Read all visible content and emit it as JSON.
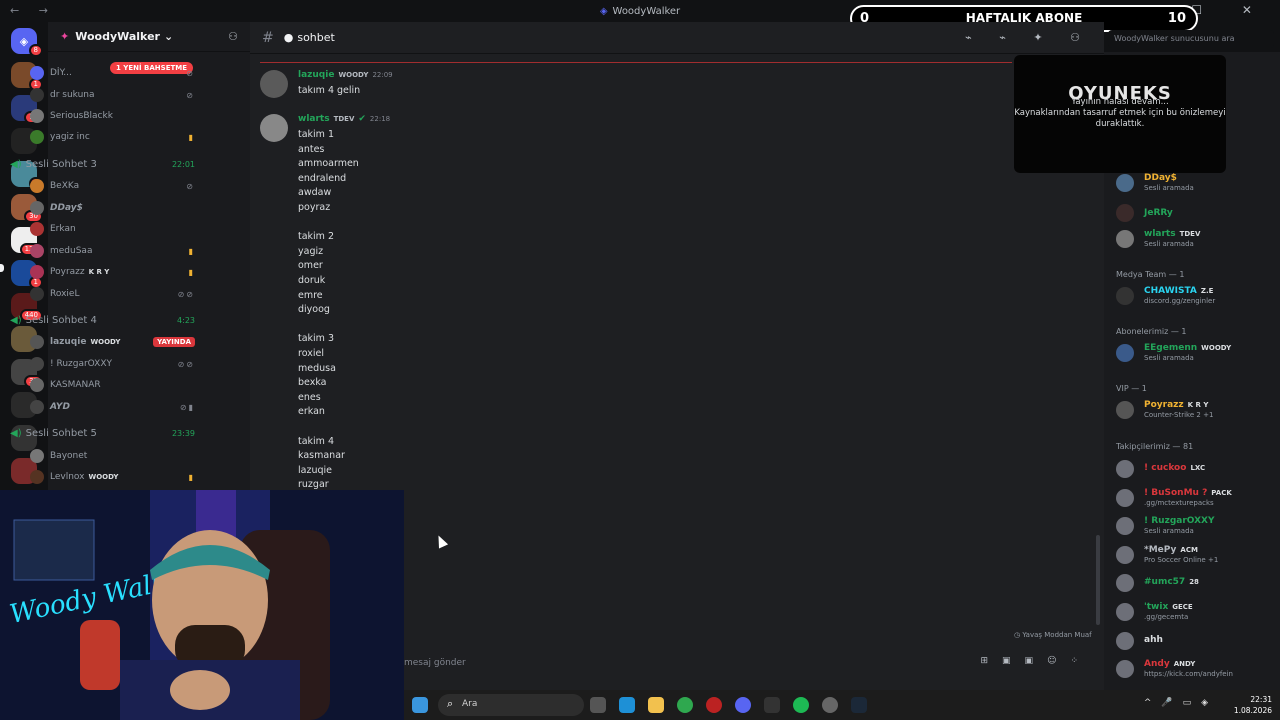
{
  "window": {
    "title": "WoodyWalker"
  },
  "server": {
    "name": "WoodyWalker",
    "new_mentions": "1 YENİ BAHSETME"
  },
  "server_badges": [
    "8",
    "1",
    "16",
    "",
    "",
    "3",
    "30",
    "126",
    "1",
    "440",
    "",
    "",
    "33",
    "",
    "",
    ""
  ],
  "voice_top_users": [
    {
      "name": "DİY..."
    },
    {
      "name": "dr sukuna"
    },
    {
      "name": "SeriousBlackk"
    },
    {
      "name": "yagiz inc"
    }
  ],
  "voice_channels": [
    {
      "name": "Sesli Sohbet 3",
      "time": "22:01",
      "live": "",
      "users": [
        {
          "name": "BeXKa",
          "tag": ""
        },
        {
          "name": "DDay$",
          "tag": ""
        },
        {
          "name": "Erkan",
          "tag": ""
        },
        {
          "name": "meduSaa",
          "tag": ""
        },
        {
          "name": "Poyrazz",
          "tag": "K R Y"
        },
        {
          "name": "RoxieL",
          "tag": ""
        }
      ]
    },
    {
      "name": "Sesli Sohbet 4",
      "time": "4:23",
      "live": "YAYINDA",
      "users": [
        {
          "name": "lazuqie",
          "tag": "WOODY"
        },
        {
          "name": "! RuzgarOXXY",
          "tag": ""
        },
        {
          "name": "KASMANAR",
          "tag": ""
        },
        {
          "name": "AYD",
          "tag": ""
        }
      ]
    },
    {
      "name": "Sesli Sohbet 5",
      "time": "23:39",
      "live": "",
      "users": [
        {
          "name": "Bayonet",
          "tag": ""
        },
        {
          "name": "Levlnox",
          "tag": "WOODY"
        }
      ]
    }
  ],
  "channel": {
    "name": "sohbet",
    "search_placeholder": "WoodyWalker sunucusunu ara"
  },
  "messages": [
    {
      "author": "lazuqie",
      "tag": "WOODY",
      "time": "22:09",
      "lines": [
        "takım 4 gelin"
      ]
    },
    {
      "author": "wlarts",
      "tag": "TDEV",
      "time": "22:18",
      "lines": [
        "takim 1",
        "antes",
        "ammoarmen",
        "endralend",
        "awdaw",
        "poyraz",
        "",
        "takim 2",
        "yagiz",
        "omer",
        "doruk",
        "emre",
        "diyoog",
        "",
        "takim 3",
        "roxiel",
        "medusa",
        "bexka",
        "enes",
        "erkan",
        "",
        "takim 4",
        "kasmanar",
        "lazuqie",
        "ruzgar"
      ]
    }
  ],
  "composer": {
    "placeholder": "mesaj gönder",
    "slowmode": "Yavaş Moddan Muaf"
  },
  "stream_preview": {
    "logo": "OYUNEKS",
    "text_line1": "Yayının halası devam...",
    "text_line2": "Kaynaklarından tasarruf etmek için bu önizlemeyi",
    "text_line3": "duraklattık."
  },
  "subscriber_bar": {
    "left": "0",
    "label": "HAFTALIK ABONE",
    "right": "10"
  },
  "members": [
    {
      "name": "DDay$",
      "status": "Sesli aramada",
      "tag": "",
      "color": "#f0b232"
    },
    {
      "name": "JeRRy",
      "status": "",
      "tag": "",
      "color": "#23a55a"
    },
    {
      "name": "wlarts",
      "status": "Sesli aramada",
      "tag": "TDEV",
      "color": "#23a55a"
    }
  ],
  "member_groups": [
    {
      "title": "Medya Team — 1",
      "members": [
        {
          "name": "CHAWISTA",
          "status": "discord.gg/zenginler",
          "tag": "Z.E",
          "color": "#2ad4f0"
        }
      ]
    },
    {
      "title": "Abonelerimiz — 1",
      "members": [
        {
          "name": "EEgemenn",
          "status": "Sesli aramada",
          "tag": "WOODY",
          "color": "#23a55a"
        }
      ]
    },
    {
      "title": "VIP — 1",
      "members": [
        {
          "name": "Poyrazz",
          "status": "Counter-Strike 2 +1",
          "tag": "K R Y",
          "color": "#f0b232"
        }
      ]
    },
    {
      "title": "Takipçilerimiz — 81",
      "members": [
        {
          "name": "! cuckoo",
          "status": "",
          "tag": "LXC",
          "color": "#da373c"
        },
        {
          "name": "! BuSonMu ?",
          "status": ".gg/mctexturepacks",
          "tag": "PACK",
          "color": "#da373c"
        },
        {
          "name": "! RuzgarOXXY",
          "status": "Sesli aramada",
          "tag": "",
          "color": "#23a55a"
        },
        {
          "name": "*MePy",
          "status": "Pro Soccer Online +1",
          "tag": "ACM",
          "color": "#b5bac1"
        },
        {
          "name": "#umc57",
          "status": "",
          "tag": "28",
          "color": "#23a55a"
        },
        {
          "name": "'twix",
          "status": ".gg/gecemta",
          "tag": "GECE",
          "color": "#23a55a"
        },
        {
          "name": "ahh",
          "status": "",
          "tag": "",
          "color": "#dbdee1"
        },
        {
          "name": "Andy",
          "status": "https://kick.com/andyfein",
          "tag": "ANDY",
          "color": "#da373c"
        }
      ]
    }
  ],
  "taskbar": {
    "search": "Ara",
    "time": "22:31",
    "date": "1.08.2026"
  },
  "webcam": {
    "neon_text": "Woody Walker"
  }
}
